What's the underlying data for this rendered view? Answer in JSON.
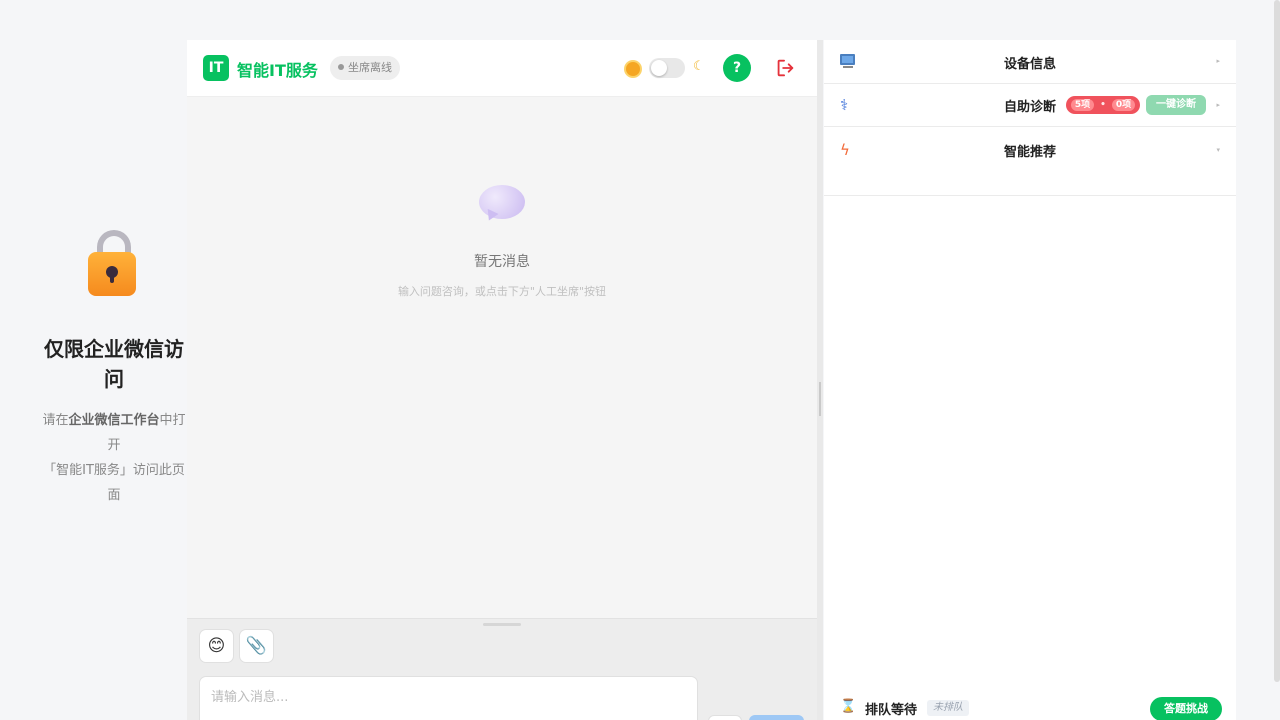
{
  "lock_panel": {
    "title": "仅限企业微信访问",
    "desc_pre": "请在",
    "desc_bold": "企业微信工作台",
    "desc_post": "中打开",
    "desc_line2": "「智能IT服务」访问此页面"
  },
  "header": {
    "logo": "IT",
    "app_title": "智能IT服务",
    "agent_status": "坐席离线",
    "help_label": "?"
  },
  "chat": {
    "empty_title": "暂无消息",
    "empty_hint": "输入问题咨询，或点击下方\"人工坐席\"按钮"
  },
  "composer": {
    "emoji": "😊",
    "attach": "📎",
    "placeholder": "请输入消息..."
  },
  "side_panel": {
    "device_title": "设备信息",
    "diag_title": "自助诊断",
    "error_count_1": "5项",
    "error_count_2": "0项",
    "one_click_label": "一键诊断",
    "rec_title": "智能推荐",
    "queue_title": "排队等待",
    "queue_status": "未排队",
    "quiz_label": "答题挑战"
  },
  "icons": {
    "lock": "lock-icon",
    "bubble": "chat-bubble-icon",
    "sun": "sun-icon",
    "moon": "moon-icon",
    "logout": "logout-icon",
    "pc": "computer-icon",
    "stethoscope": "stethoscope-icon",
    "bolt": "bolt-icon",
    "hourglass": "hourglass-icon"
  },
  "colors": {
    "brand_green": "#07c160",
    "error_red": "#f0525c",
    "logout_red": "#e5323b"
  }
}
